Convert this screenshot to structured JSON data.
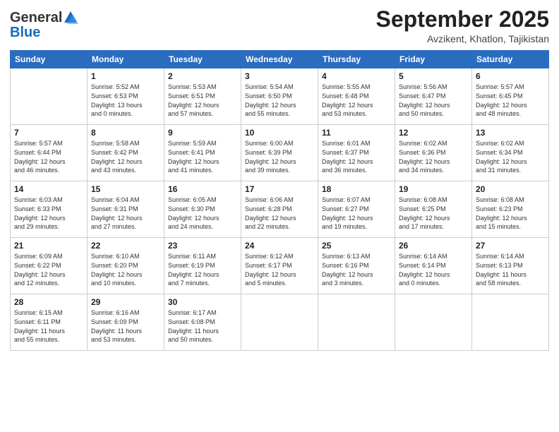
{
  "header": {
    "logo_general": "General",
    "logo_blue": "Blue",
    "month": "September 2025",
    "location": "Avzikent, Khatlon, Tajikistan"
  },
  "days_of_week": [
    "Sunday",
    "Monday",
    "Tuesday",
    "Wednesday",
    "Thursday",
    "Friday",
    "Saturday"
  ],
  "weeks": [
    [
      {
        "day": "",
        "info": ""
      },
      {
        "day": "1",
        "info": "Sunrise: 5:52 AM\nSunset: 6:53 PM\nDaylight: 13 hours\nand 0 minutes."
      },
      {
        "day": "2",
        "info": "Sunrise: 5:53 AM\nSunset: 6:51 PM\nDaylight: 12 hours\nand 57 minutes."
      },
      {
        "day": "3",
        "info": "Sunrise: 5:54 AM\nSunset: 6:50 PM\nDaylight: 12 hours\nand 55 minutes."
      },
      {
        "day": "4",
        "info": "Sunrise: 5:55 AM\nSunset: 6:48 PM\nDaylight: 12 hours\nand 53 minutes."
      },
      {
        "day": "5",
        "info": "Sunrise: 5:56 AM\nSunset: 6:47 PM\nDaylight: 12 hours\nand 50 minutes."
      },
      {
        "day": "6",
        "info": "Sunrise: 5:57 AM\nSunset: 6:45 PM\nDaylight: 12 hours\nand 48 minutes."
      }
    ],
    [
      {
        "day": "7",
        "info": "Sunrise: 5:57 AM\nSunset: 6:44 PM\nDaylight: 12 hours\nand 46 minutes."
      },
      {
        "day": "8",
        "info": "Sunrise: 5:58 AM\nSunset: 6:42 PM\nDaylight: 12 hours\nand 43 minutes."
      },
      {
        "day": "9",
        "info": "Sunrise: 5:59 AM\nSunset: 6:41 PM\nDaylight: 12 hours\nand 41 minutes."
      },
      {
        "day": "10",
        "info": "Sunrise: 6:00 AM\nSunset: 6:39 PM\nDaylight: 12 hours\nand 39 minutes."
      },
      {
        "day": "11",
        "info": "Sunrise: 6:01 AM\nSunset: 6:37 PM\nDaylight: 12 hours\nand 36 minutes."
      },
      {
        "day": "12",
        "info": "Sunrise: 6:02 AM\nSunset: 6:36 PM\nDaylight: 12 hours\nand 34 minutes."
      },
      {
        "day": "13",
        "info": "Sunrise: 6:02 AM\nSunset: 6:34 PM\nDaylight: 12 hours\nand 31 minutes."
      }
    ],
    [
      {
        "day": "14",
        "info": "Sunrise: 6:03 AM\nSunset: 6:33 PM\nDaylight: 12 hours\nand 29 minutes."
      },
      {
        "day": "15",
        "info": "Sunrise: 6:04 AM\nSunset: 6:31 PM\nDaylight: 12 hours\nand 27 minutes."
      },
      {
        "day": "16",
        "info": "Sunrise: 6:05 AM\nSunset: 6:30 PM\nDaylight: 12 hours\nand 24 minutes."
      },
      {
        "day": "17",
        "info": "Sunrise: 6:06 AM\nSunset: 6:28 PM\nDaylight: 12 hours\nand 22 minutes."
      },
      {
        "day": "18",
        "info": "Sunrise: 6:07 AM\nSunset: 6:27 PM\nDaylight: 12 hours\nand 19 minutes."
      },
      {
        "day": "19",
        "info": "Sunrise: 6:08 AM\nSunset: 6:25 PM\nDaylight: 12 hours\nand 17 minutes."
      },
      {
        "day": "20",
        "info": "Sunrise: 6:08 AM\nSunset: 6:23 PM\nDaylight: 12 hours\nand 15 minutes."
      }
    ],
    [
      {
        "day": "21",
        "info": "Sunrise: 6:09 AM\nSunset: 6:22 PM\nDaylight: 12 hours\nand 12 minutes."
      },
      {
        "day": "22",
        "info": "Sunrise: 6:10 AM\nSunset: 6:20 PM\nDaylight: 12 hours\nand 10 minutes."
      },
      {
        "day": "23",
        "info": "Sunrise: 6:11 AM\nSunset: 6:19 PM\nDaylight: 12 hours\nand 7 minutes."
      },
      {
        "day": "24",
        "info": "Sunrise: 6:12 AM\nSunset: 6:17 PM\nDaylight: 12 hours\nand 5 minutes."
      },
      {
        "day": "25",
        "info": "Sunrise: 6:13 AM\nSunset: 6:16 PM\nDaylight: 12 hours\nand 3 minutes."
      },
      {
        "day": "26",
        "info": "Sunrise: 6:14 AM\nSunset: 6:14 PM\nDaylight: 12 hours\nand 0 minutes."
      },
      {
        "day": "27",
        "info": "Sunrise: 6:14 AM\nSunset: 6:13 PM\nDaylight: 11 hours\nand 58 minutes."
      }
    ],
    [
      {
        "day": "28",
        "info": "Sunrise: 6:15 AM\nSunset: 6:11 PM\nDaylight: 11 hours\nand 55 minutes."
      },
      {
        "day": "29",
        "info": "Sunrise: 6:16 AM\nSunset: 6:09 PM\nDaylight: 11 hours\nand 53 minutes."
      },
      {
        "day": "30",
        "info": "Sunrise: 6:17 AM\nSunset: 6:08 PM\nDaylight: 11 hours\nand 50 minutes."
      },
      {
        "day": "",
        "info": ""
      },
      {
        "day": "",
        "info": ""
      },
      {
        "day": "",
        "info": ""
      },
      {
        "day": "",
        "info": ""
      }
    ]
  ]
}
